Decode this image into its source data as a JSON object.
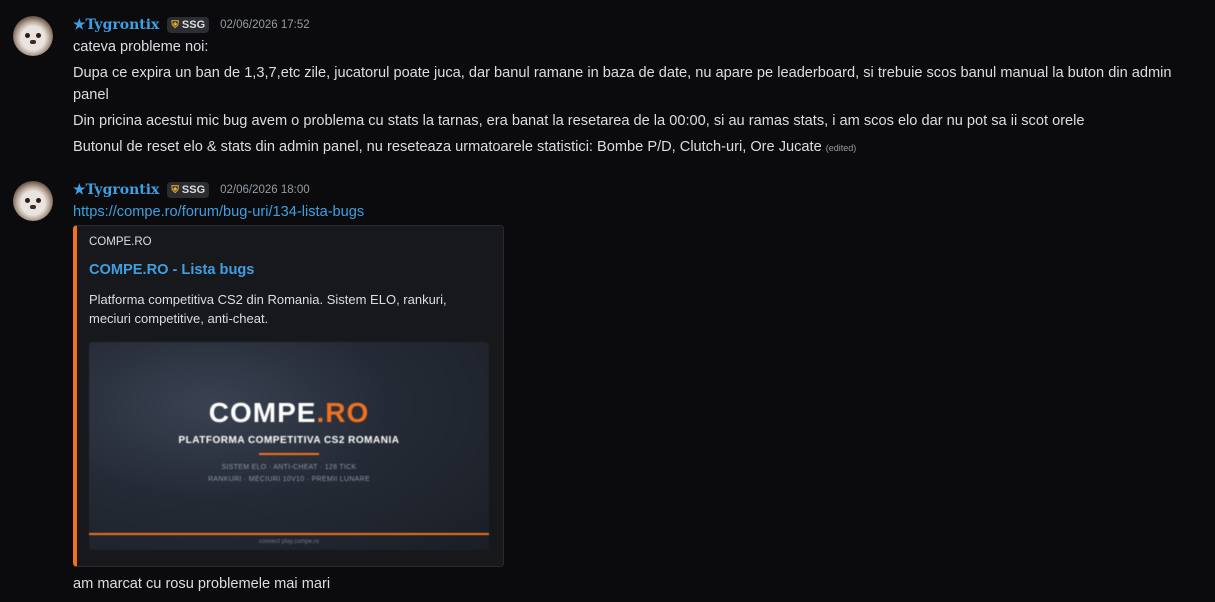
{
  "messages": [
    {
      "author": "★Tygrontix",
      "tag": {
        "icon": "shield-icon",
        "label": "SSG"
      },
      "timestamp": "02/06/2026 17:52",
      "lines": [
        "cateva probleme noi:",
        "Dupa ce expira un ban de 1,3,7,etc zile, jucatorul poate juca, dar banul ramane in baza de date, nu apare pe leaderboard, si trebuie scos banul manual la buton din admin",
        "panel",
        "Din pricina acestui mic bug avem o problema cu stats la tarnas, era banat la resetarea de la 00:00, si au ramas stats, i am scos elo dar nu pot sa ii scot orele",
        "Butonul de reset elo & stats din admin panel, nu reseteaza urmatoarele statistici: Bombe P/D, Clutch-uri, Ore Jucate"
      ],
      "edited_label": "(edited)"
    },
    {
      "author": "★Tygrontix",
      "tag": {
        "icon": "shield-icon",
        "label": "SSG"
      },
      "timestamp": "02/06/2026 18:00",
      "link": "https://compe.ro/forum/bug-uri/134-lista-bugs",
      "embed": {
        "accent": "#f0711f",
        "provider": "COMPE.RO",
        "title": "COMPE.RO - Lista bugs",
        "description_line1": "Platforma competitiva CS2 din Romania. Sistem ELO, rankuri,",
        "description_line2": "meciuri competitive, anti-cheat.",
        "image": {
          "logo_main": "COMPE",
          "logo_dot": ".RO",
          "subtitle": "PLATFORMA COMPETITIVA CS2 ROMANIA",
          "features_line1": "SISTEM ELO  ·  ANTI-CHEAT  ·  128 TICK",
          "features_line2": "RANKURI  ·  MECIURI 10V10  ·  PREMII LUNARE",
          "footer": "connect play.compe.ro"
        }
      },
      "followup": "am marcat cu rosu problemele mai mari"
    }
  ],
  "colors": {
    "background": "#0b0b0d",
    "username": "#3f9fe2",
    "link": "#3f9fe2",
    "text": "#dbdee1",
    "muted": "#949ba4"
  }
}
